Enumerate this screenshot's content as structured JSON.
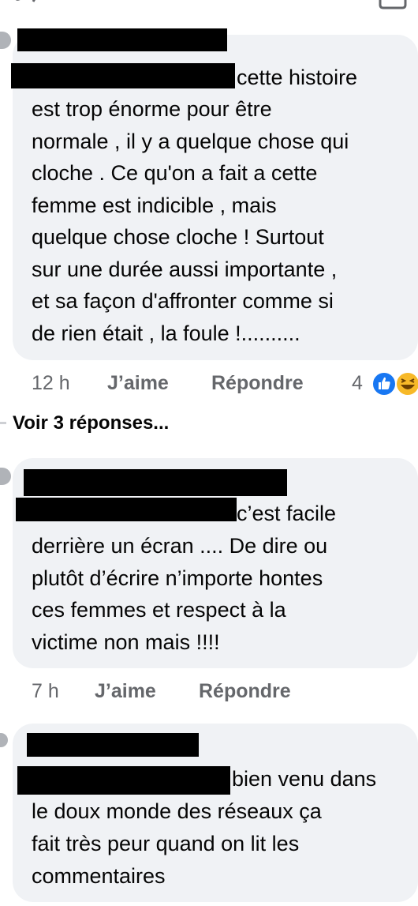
{
  "comments": [
    {
      "lines": [
        "cette histoire",
        "est trop énorme pour être",
        "normale , il y a quelque chose qui",
        "cloche . Ce qu'on a fait a cette",
        "femme est indicible , mais",
        "quelque chose cloche ! Surtout",
        "sur une durée aussi importante ,",
        "et sa façon d'affronter comme si",
        "de rien était , la foule !.........."
      ],
      "time": "12 h",
      "like_label": "J’aime",
      "reply_label": "Répondre",
      "reaction_count": "4"
    },
    {
      "lines": [
        "c’est facile",
        "derrière un écran .... De dire ou",
        "plutôt d’écrire n’importe hontes",
        "ces femmes et respect à la",
        "victime non mais !!!!"
      ],
      "time": "7 h",
      "like_label": "J’aime",
      "reply_label": "Répondre"
    },
    {
      "lines": [
        "bien venu dans",
        "le doux monde des réseaux ça",
        "fait très peur quand on lit les",
        "commentaires"
      ]
    }
  ],
  "view_replies": "Voir 3 réponses...",
  "icons": [
    "back-chevron-icon",
    "comment-box-icon",
    "like-reaction-icon",
    "haha-reaction-icon"
  ],
  "colors": {
    "bubble": "#f0f2f5",
    "meta": "#65676b",
    "like_blue": "#1877f2",
    "haha_yellow": "#f7b928"
  }
}
